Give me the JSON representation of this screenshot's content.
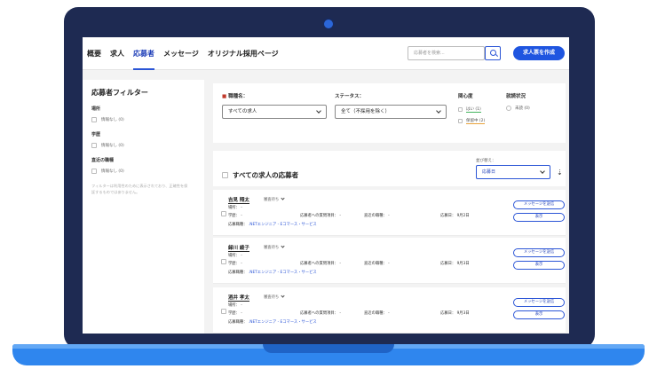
{
  "header": {
    "nav": [
      "概要",
      "求人",
      "応募者",
      "メッセージ",
      "オリジナル採用ページ"
    ],
    "active_index": 2,
    "search_placeholder": "応募者を検索...",
    "create_button": "求人票を作成"
  },
  "sidebar": {
    "title": "応募者フィルター",
    "sections": [
      {
        "label": "場所",
        "option": "情報なし (0)"
      },
      {
        "label": "学歴",
        "option": "情報なし (0)"
      },
      {
        "label": "直近の職種",
        "option": "情報なし (0)"
      }
    ],
    "note": "フィルターは利用性のために表示されており、正確性を保証するものではありません。"
  },
  "filters": {
    "job_label": "職種名：",
    "job_value": "すべての求人",
    "status_label": "ステータス：",
    "status_value": "全て（不採用を除く）",
    "interest_label": "関心度",
    "interest_options": [
      "はい (1)",
      "保留中 (2)"
    ],
    "screening_label": "就読状況",
    "screening_option": "未読 (0)"
  },
  "list": {
    "title": "すべての求人の応募者",
    "sort_label": "並び替え：",
    "sort_value": "応募日",
    "sort_icon": "⇣"
  },
  "labels": {
    "location": "場所：",
    "education": "学歴：",
    "applied_job": "応募職種：",
    "question": "応募者への質問項目：",
    "recent_job": "直近の職種：",
    "applied_date": "応募日："
  },
  "applicants": [
    {
      "name": "吉見 翔太",
      "status": "審査待ち",
      "location": "-",
      "education": "-",
      "question": "-",
      "recent_job": "-",
      "date": "9月2日",
      "job": ".NETエンジニア - Eコマース・サービス"
    },
    {
      "name": "緑川 綾子",
      "status": "審査待ち",
      "location": "-",
      "education": "-",
      "question": "-",
      "recent_job": "-",
      "date": "9月3日",
      "job": ".NETエンジニア - Eコマース・サービス"
    },
    {
      "name": "酒井 孝太",
      "status": "審査待ち",
      "location": "-",
      "education": "-",
      "question": "-",
      "recent_job": "-",
      "date": "9月3日",
      "job": ".NETエンジニア - Eコマース・サービス"
    }
  ],
  "card_buttons": {
    "message": "メッセージを送信",
    "view": "表示"
  },
  "colors": {
    "accent": "#1f55e0",
    "bezel": "#1e2a52",
    "base": "#2f86ee"
  }
}
